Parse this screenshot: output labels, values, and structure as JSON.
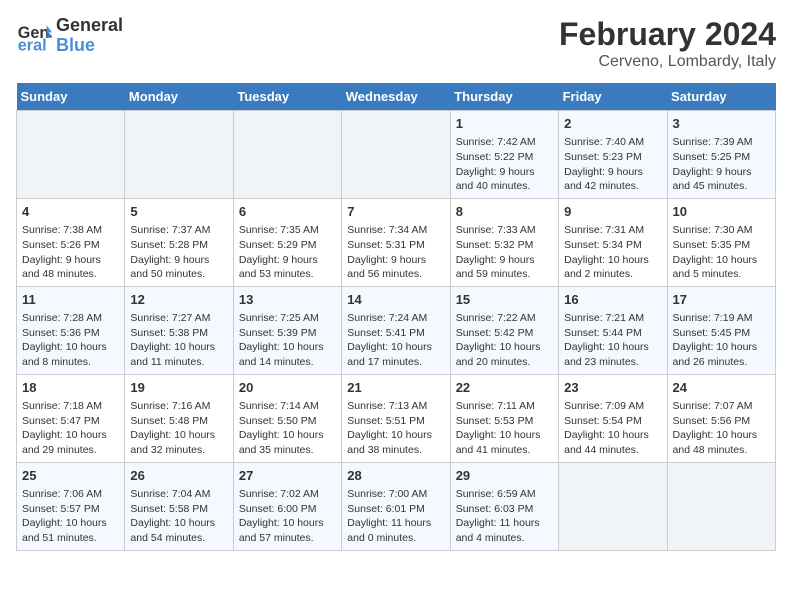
{
  "header": {
    "logo_line1": "General",
    "logo_line2": "Blue",
    "title": "February 2024",
    "subtitle": "Cerveno, Lombardy, Italy"
  },
  "weekdays": [
    "Sunday",
    "Monday",
    "Tuesday",
    "Wednesday",
    "Thursday",
    "Friday",
    "Saturday"
  ],
  "weeks": [
    [
      {
        "day": "",
        "info": ""
      },
      {
        "day": "",
        "info": ""
      },
      {
        "day": "",
        "info": ""
      },
      {
        "day": "",
        "info": ""
      },
      {
        "day": "1",
        "info": "Sunrise: 7:42 AM\nSunset: 5:22 PM\nDaylight: 9 hours\nand 40 minutes."
      },
      {
        "day": "2",
        "info": "Sunrise: 7:40 AM\nSunset: 5:23 PM\nDaylight: 9 hours\nand 42 minutes."
      },
      {
        "day": "3",
        "info": "Sunrise: 7:39 AM\nSunset: 5:25 PM\nDaylight: 9 hours\nand 45 minutes."
      }
    ],
    [
      {
        "day": "4",
        "info": "Sunrise: 7:38 AM\nSunset: 5:26 PM\nDaylight: 9 hours\nand 48 minutes."
      },
      {
        "day": "5",
        "info": "Sunrise: 7:37 AM\nSunset: 5:28 PM\nDaylight: 9 hours\nand 50 minutes."
      },
      {
        "day": "6",
        "info": "Sunrise: 7:35 AM\nSunset: 5:29 PM\nDaylight: 9 hours\nand 53 minutes."
      },
      {
        "day": "7",
        "info": "Sunrise: 7:34 AM\nSunset: 5:31 PM\nDaylight: 9 hours\nand 56 minutes."
      },
      {
        "day": "8",
        "info": "Sunrise: 7:33 AM\nSunset: 5:32 PM\nDaylight: 9 hours\nand 59 minutes."
      },
      {
        "day": "9",
        "info": "Sunrise: 7:31 AM\nSunset: 5:34 PM\nDaylight: 10 hours\nand 2 minutes."
      },
      {
        "day": "10",
        "info": "Sunrise: 7:30 AM\nSunset: 5:35 PM\nDaylight: 10 hours\nand 5 minutes."
      }
    ],
    [
      {
        "day": "11",
        "info": "Sunrise: 7:28 AM\nSunset: 5:36 PM\nDaylight: 10 hours\nand 8 minutes."
      },
      {
        "day": "12",
        "info": "Sunrise: 7:27 AM\nSunset: 5:38 PM\nDaylight: 10 hours\nand 11 minutes."
      },
      {
        "day": "13",
        "info": "Sunrise: 7:25 AM\nSunset: 5:39 PM\nDaylight: 10 hours\nand 14 minutes."
      },
      {
        "day": "14",
        "info": "Sunrise: 7:24 AM\nSunset: 5:41 PM\nDaylight: 10 hours\nand 17 minutes."
      },
      {
        "day": "15",
        "info": "Sunrise: 7:22 AM\nSunset: 5:42 PM\nDaylight: 10 hours\nand 20 minutes."
      },
      {
        "day": "16",
        "info": "Sunrise: 7:21 AM\nSunset: 5:44 PM\nDaylight: 10 hours\nand 23 minutes."
      },
      {
        "day": "17",
        "info": "Sunrise: 7:19 AM\nSunset: 5:45 PM\nDaylight: 10 hours\nand 26 minutes."
      }
    ],
    [
      {
        "day": "18",
        "info": "Sunrise: 7:18 AM\nSunset: 5:47 PM\nDaylight: 10 hours\nand 29 minutes."
      },
      {
        "day": "19",
        "info": "Sunrise: 7:16 AM\nSunset: 5:48 PM\nDaylight: 10 hours\nand 32 minutes."
      },
      {
        "day": "20",
        "info": "Sunrise: 7:14 AM\nSunset: 5:50 PM\nDaylight: 10 hours\nand 35 minutes."
      },
      {
        "day": "21",
        "info": "Sunrise: 7:13 AM\nSunset: 5:51 PM\nDaylight: 10 hours\nand 38 minutes."
      },
      {
        "day": "22",
        "info": "Sunrise: 7:11 AM\nSunset: 5:53 PM\nDaylight: 10 hours\nand 41 minutes."
      },
      {
        "day": "23",
        "info": "Sunrise: 7:09 AM\nSunset: 5:54 PM\nDaylight: 10 hours\nand 44 minutes."
      },
      {
        "day": "24",
        "info": "Sunrise: 7:07 AM\nSunset: 5:56 PM\nDaylight: 10 hours\nand 48 minutes."
      }
    ],
    [
      {
        "day": "25",
        "info": "Sunrise: 7:06 AM\nSunset: 5:57 PM\nDaylight: 10 hours\nand 51 minutes."
      },
      {
        "day": "26",
        "info": "Sunrise: 7:04 AM\nSunset: 5:58 PM\nDaylight: 10 hours\nand 54 minutes."
      },
      {
        "day": "27",
        "info": "Sunrise: 7:02 AM\nSunset: 6:00 PM\nDaylight: 10 hours\nand 57 minutes."
      },
      {
        "day": "28",
        "info": "Sunrise: 7:00 AM\nSunset: 6:01 PM\nDaylight: 11 hours\nand 0 minutes."
      },
      {
        "day": "29",
        "info": "Sunrise: 6:59 AM\nSunset: 6:03 PM\nDaylight: 11 hours\nand 4 minutes."
      },
      {
        "day": "",
        "info": ""
      },
      {
        "day": "",
        "info": ""
      }
    ]
  ]
}
